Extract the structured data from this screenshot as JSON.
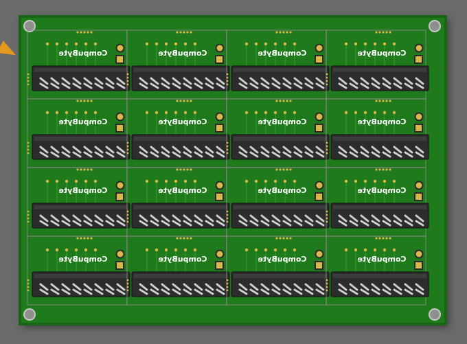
{
  "board": {
    "silkscreen_text": "CompuByte",
    "rows": 4,
    "cols": 4,
    "header_pins_per_row": 8,
    "colors": {
      "board": "#1f7a1c",
      "board_dark": "#186516",
      "trace": "#2f9a2a",
      "pad": "#d8b84a",
      "header_body": "#2c2c2c",
      "pin": "#cfcfcf",
      "silkscreen": "#ffffff",
      "background": "#6a6a6a",
      "accent": "#e39a1c"
    }
  }
}
